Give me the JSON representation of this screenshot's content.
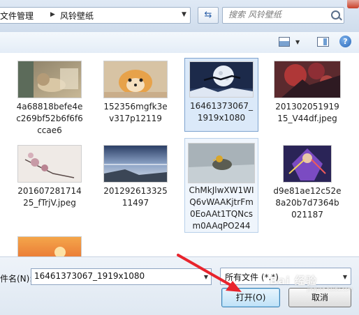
{
  "address_bar": {
    "path": [
      "文件管理",
      "风铃壁纸"
    ],
    "search_placeholder": "搜索 风铃壁纸"
  },
  "toolbar": {
    "icons": [
      "views-icon",
      "preview-pane-icon",
      "help-icon"
    ],
    "help_glyph": "?"
  },
  "files": [
    {
      "name": "4a68818befe4ec269bf52b6f6f6ccae6",
      "selected": false
    },
    {
      "name": "152356mgfk3ev317p12119",
      "selected": false
    },
    {
      "name": "16461373067_1919x1080",
      "selected": true
    },
    {
      "name": "20130205191915_V44df.jpeg",
      "selected": false
    },
    {
      "name": "20160728171425_fTrjV.jpeg",
      "selected": false
    },
    {
      "name": "20129261332511497",
      "selected": false
    },
    {
      "name": "ChMkJlwXW1WIQ6vWAAKjtrFm0EoAAt1TQNcsm0AAqPO244",
      "selected": false,
      "hover": true
    },
    {
      "name": "d9e81ae12c52e8a20b7d7364b021187",
      "selected": false
    },
    {
      "name": "",
      "selected": false
    }
  ],
  "bottom": {
    "filename_label": "件名(N):",
    "filename_value": "16461373067_1919x1080",
    "filetype": "所有文件 (*.*)",
    "open_label": "打开(O)",
    "cancel_label": "取消"
  },
  "watermark": {
    "text": "Bai 经验",
    "sub": "jingyan.baidu.com"
  },
  "colors": {
    "selection": "#dbe9f9",
    "selection_border": "#7da2ce",
    "arrow": "#e8242d"
  }
}
